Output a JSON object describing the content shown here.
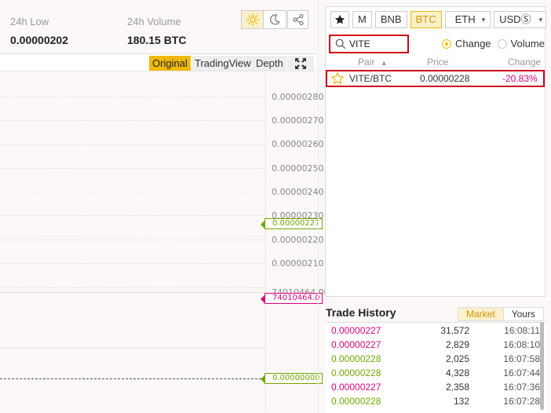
{
  "stats": {
    "low_label": "24h Low",
    "low_value": "0.00000202",
    "volume_label": "24h Volume",
    "volume_value": "180.15 BTC"
  },
  "theme_toggle": {
    "icons": [
      "sun-icon",
      "moon-icon"
    ],
    "active": "sun-icon"
  },
  "chart_toolbar": {
    "original": "Original",
    "tradingview": "TradingView",
    "depth": "Depth"
  },
  "axis_labels": [
    "0.00000280",
    "0.00000270",
    "0.00000260",
    "0.00000250",
    "0.00000240",
    "0.00000230",
    "0.00000220",
    "0.00000210",
    "74010464.00"
  ],
  "tags": {
    "price_tag": "0.00000227",
    "volume_tag": "74010464.0",
    "indicator_tag": "0.00000000"
  },
  "market": {
    "tabs": [
      "M",
      "BNB",
      "BTC",
      "ETH",
      "USDⓈ"
    ],
    "active_tab": "BTC",
    "search_value": "VITE",
    "radio_change": "Change",
    "radio_volume": "Volume",
    "col_pair": "Pair",
    "col_price": "Price",
    "col_change": "Change",
    "rows": [
      {
        "pair": "VITE/BTC",
        "price": "0.00000228",
        "change": "-20.83%"
      }
    ]
  },
  "trade_history": {
    "title": "Trade History",
    "tab_market": "Market",
    "tab_yours": "Yours",
    "rows": [
      {
        "price": "0.00000227",
        "amount": "31,572",
        "time": "16:08:11",
        "dir": "down"
      },
      {
        "price": "0.00000227",
        "amount": "2,829",
        "time": "16:08:10",
        "dir": "down"
      },
      {
        "price": "0.00000228",
        "amount": "2,025",
        "time": "16:07:58",
        "dir": "up"
      },
      {
        "price": "0.00000228",
        "amount": "4,328",
        "time": "16:07:44",
        "dir": "up"
      },
      {
        "price": "0.00000227",
        "amount": "2,358",
        "time": "16:07:36",
        "dir": "down"
      },
      {
        "price": "0.00000228",
        "amount": "132",
        "time": "16:07:28",
        "dir": "up"
      }
    ]
  },
  "colors": {
    "accent": "#f0b90b",
    "up": "#70a800",
    "down": "#d9047c",
    "highlight": "#d0021b"
  }
}
